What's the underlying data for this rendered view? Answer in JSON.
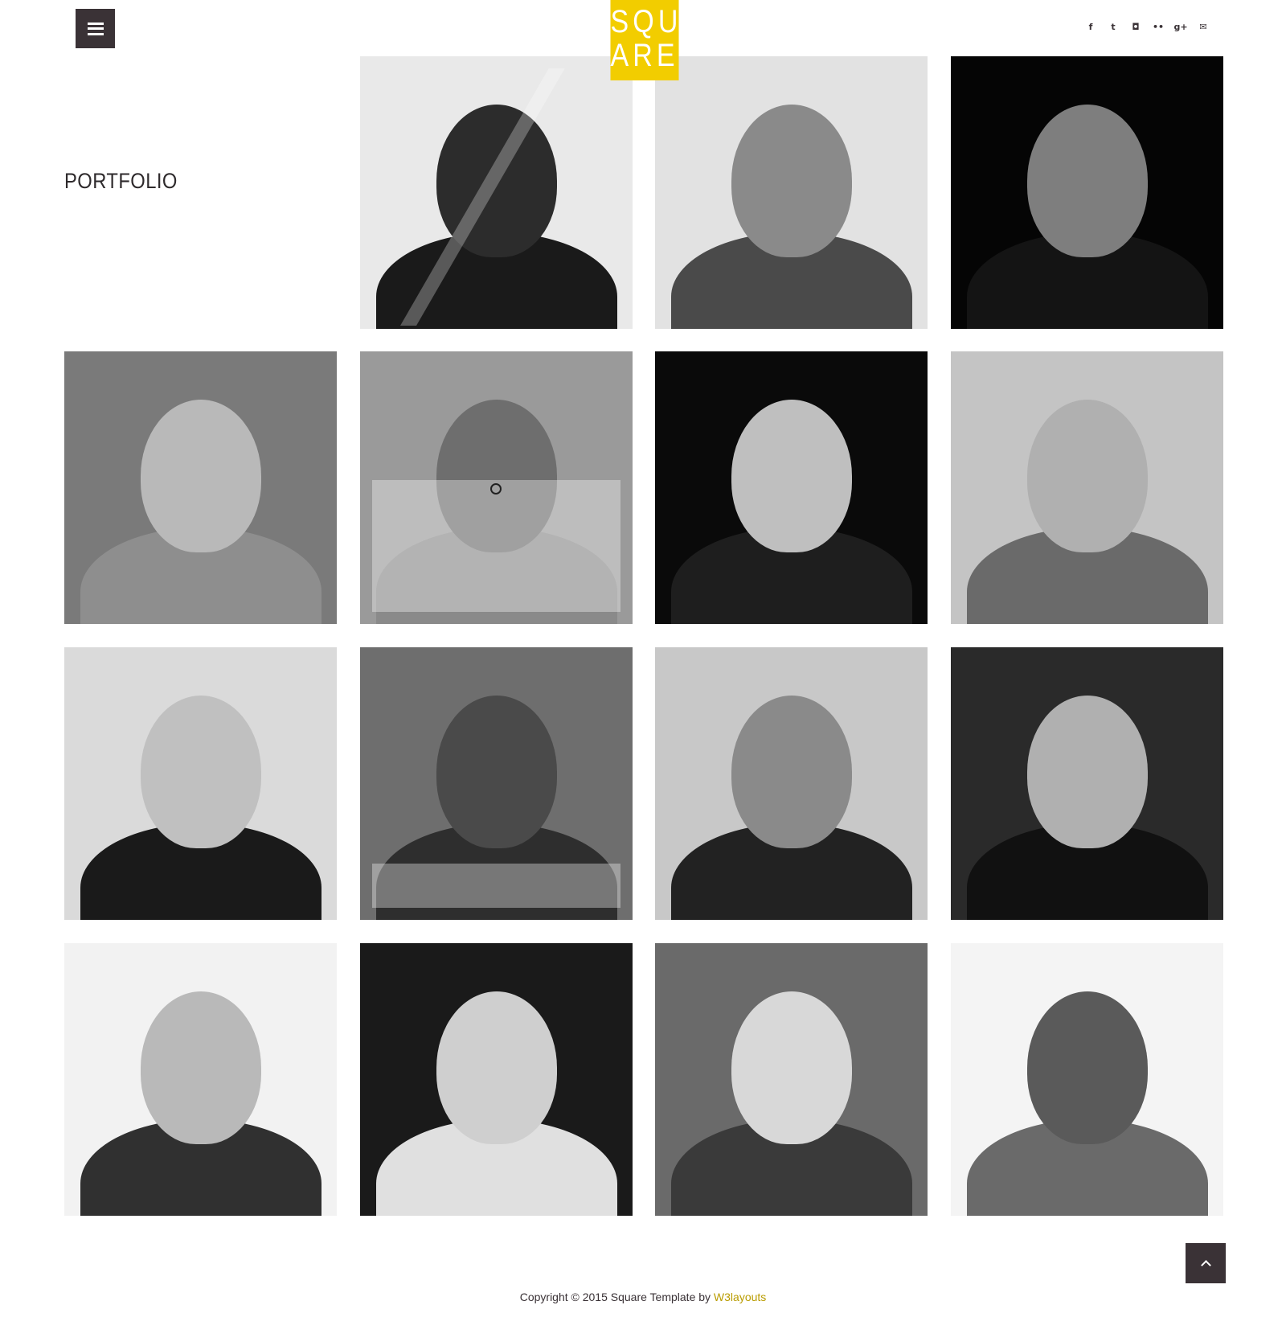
{
  "header": {
    "menu_icon": "hamburger-menu-icon",
    "logo_line1": "SQU",
    "logo_line2": "ARE",
    "logo_color": "#f2cd00",
    "social_icons": [
      {
        "name": "facebook-icon",
        "glyph": "f"
      },
      {
        "name": "twitter-icon",
        "glyph": "t"
      },
      {
        "name": "instagram-icon",
        "glyph": "◘"
      },
      {
        "name": "flickr-icon",
        "glyph": "••"
      },
      {
        "name": "google-plus-icon",
        "glyph": "g+"
      },
      {
        "name": "email-icon",
        "glyph": "✉"
      }
    ]
  },
  "section": {
    "title": "PORTFOLIO"
  },
  "gallery": {
    "items": [
      {
        "tone": "light",
        "bg": "#e9e9e9",
        "face": "#2c2c2c",
        "body": "#1a1a1a"
      },
      {
        "tone": "light",
        "bg": "#e2e2e2",
        "face": "#8a8a8a",
        "body": "#4a4a4a"
      },
      {
        "tone": "dark",
        "bg": "#050505",
        "face": "#7e7e7e",
        "body": "#141414"
      },
      {
        "tone": "mid",
        "bg": "#7a7a7a",
        "face": "#b9b9b9",
        "body": "#8e8e8e"
      },
      {
        "tone": "mid",
        "bg": "#9a9a9a",
        "face": "#6e6e6e",
        "body": "#8a8a8a"
      },
      {
        "tone": "dark",
        "bg": "#0a0a0a",
        "face": "#bfbfbf",
        "body": "#1e1e1e"
      },
      {
        "tone": "light",
        "bg": "#c4c4c4",
        "face": "#b0b0b0",
        "body": "#6a6a6a"
      },
      {
        "tone": "mid",
        "bg": "#dadada",
        "face": "#c0c0c0",
        "body": "#1a1a1a"
      },
      {
        "tone": "mid",
        "bg": "#6e6e6e",
        "face": "#4a4a4a",
        "body": "#2e2e2e"
      },
      {
        "tone": "mid",
        "bg": "#c8c8c8",
        "face": "#8a8a8a",
        "body": "#222222"
      },
      {
        "tone": "dark",
        "bg": "#2a2a2a",
        "face": "#b0b0b0",
        "body": "#111111"
      },
      {
        "tone": "light",
        "bg": "#f2f2f2",
        "face": "#b9b9b9",
        "body": "#303030"
      },
      {
        "tone": "dark",
        "bg": "#1a1a1a",
        "face": "#cfcfcf",
        "body": "#e0e0e0"
      },
      {
        "tone": "mid",
        "bg": "#6a6a6a",
        "face": "#d8d8d8",
        "body": "#3a3a3a"
      },
      {
        "tone": "light",
        "bg": "#f4f4f4",
        "face": "#5a5a5a",
        "body": "#6a6a6a"
      }
    ]
  },
  "footer": {
    "copyright": "Copyright © 2015 Square Template by ",
    "link_text": "W3layouts",
    "link_color": "#b99c00"
  },
  "back_to_top_icon": "chevron-up-icon"
}
